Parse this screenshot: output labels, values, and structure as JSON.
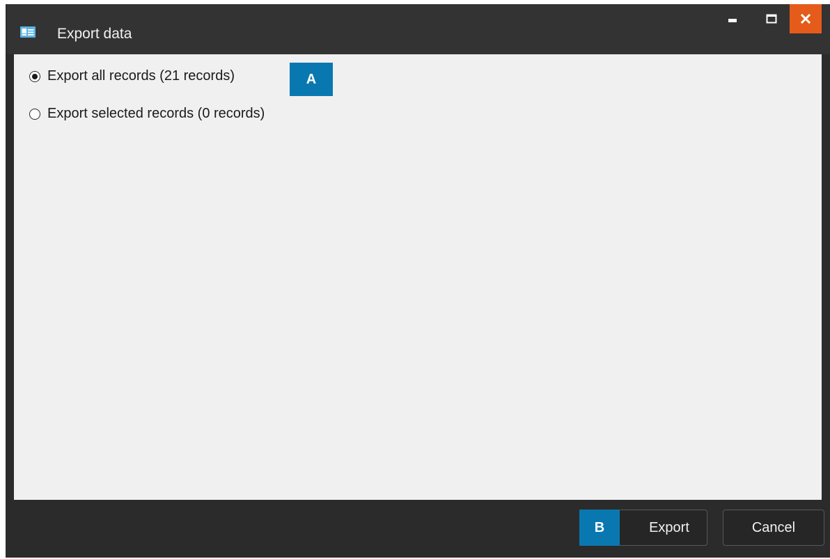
{
  "window": {
    "title": "Export data",
    "app_icon": "contact-card-icon",
    "controls": {
      "minimize_icon": "minimize-icon",
      "maximize_icon": "maximize-icon",
      "close_icon": "close-icon",
      "close_color": "#e55b1a"
    }
  },
  "options": {
    "export_all_label": "Export all records (21 records)",
    "export_selected_label": "Export selected records (0 records)",
    "selected": "export_all"
  },
  "callouts": {
    "a": "A",
    "b": "B",
    "color": "#0a78b0"
  },
  "footer": {
    "export_label": "Export",
    "cancel_label": "Cancel"
  }
}
